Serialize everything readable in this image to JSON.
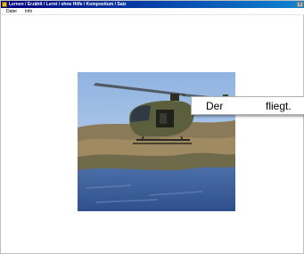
{
  "window": {
    "title": "Lernen / Erzählt / Lernt / ohne Hilfe / Kompositum / Satz",
    "close_label": "x"
  },
  "menu": {
    "items": [
      {
        "label": "Datei"
      },
      {
        "label": "Info"
      }
    ]
  },
  "exercise": {
    "sentence_words": [
      "Der",
      "fliegt."
    ]
  },
  "colors": {
    "title_bar_start": "#000080",
    "title_bar_end": "#1084d0",
    "background": "#ffffff"
  }
}
